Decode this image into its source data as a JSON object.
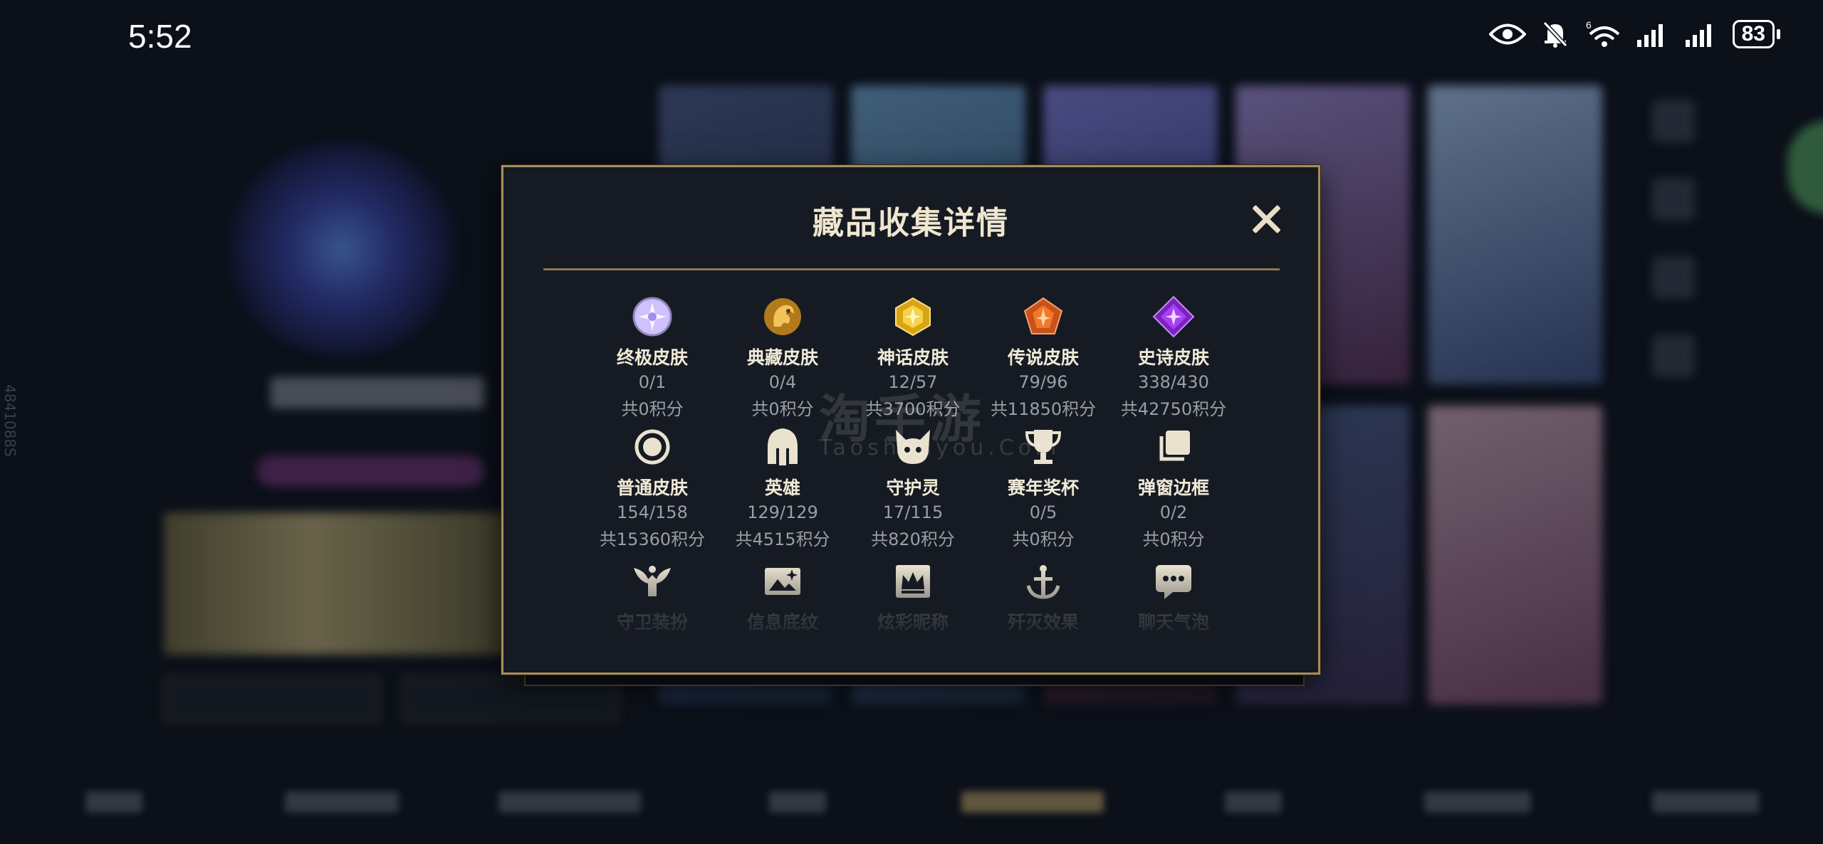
{
  "status_bar": {
    "time": "5:52",
    "battery": "83",
    "signal_small": "6"
  },
  "side_id": "4841088S",
  "modal": {
    "title": "藏品收集详情",
    "close_icon": "close-icon",
    "row1": [
      {
        "name": "终极皮肤",
        "count": "0/1",
        "points": "共0积分",
        "icon": "ultimate-skin-icon",
        "color": "#c9b8ff"
      },
      {
        "name": "典藏皮肤",
        "count": "0/4",
        "points": "共0积分",
        "icon": "collection-skin-icon",
        "color": "#e0a030"
      },
      {
        "name": "神话皮肤",
        "count": "12/57",
        "points": "共3700积分",
        "icon": "myth-skin-icon",
        "color": "#f0c232"
      },
      {
        "name": "传说皮肤",
        "count": "79/96",
        "points": "共11850积分",
        "icon": "legend-skin-icon",
        "color": "#f07a2a"
      },
      {
        "name": "史诗皮肤",
        "count": "338/430",
        "points": "共42750积分",
        "icon": "epic-skin-icon",
        "color": "#a640f0"
      }
    ],
    "row2": [
      {
        "name": "普通皮肤",
        "count": "154/158",
        "points": "共15360积分",
        "icon": "normal-skin-icon"
      },
      {
        "name": "英雄",
        "count": "129/129",
        "points": "共4515积分",
        "icon": "hero-helmet-icon"
      },
      {
        "name": "守护灵",
        "count": "17/115",
        "points": "共820积分",
        "icon": "guardian-spirit-icon"
      },
      {
        "name": "赛年奖杯",
        "count": "0/5",
        "points": "共0积分",
        "icon": "trophy-icon"
      },
      {
        "name": "弹窗边框",
        "count": "0/2",
        "points": "共0积分",
        "icon": "popup-frame-icon"
      }
    ],
    "row3": [
      {
        "name": "守卫装扮",
        "icon": "guard-outfit-icon"
      },
      {
        "name": "信息底纹",
        "icon": "info-background-icon"
      },
      {
        "name": "炫彩昵称",
        "icon": "colorful-nickname-icon"
      },
      {
        "name": "歼灭效果",
        "icon": "annihilate-effect-icon"
      },
      {
        "name": "聊天气泡",
        "icon": "chat-bubble-icon"
      }
    ]
  },
  "watermark": {
    "cn": "淘手游",
    "en": "Taoshouyou.Com"
  }
}
